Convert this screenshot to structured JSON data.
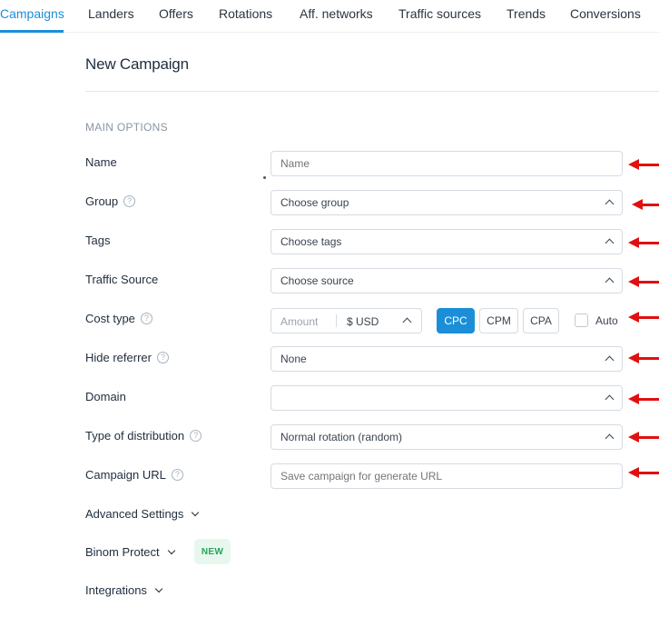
{
  "nav": {
    "tabs": [
      {
        "label": "Campaigns",
        "active": true
      },
      {
        "label": "Landers"
      },
      {
        "label": "Offers"
      },
      {
        "label": "Rotations"
      },
      {
        "label": "Aff. networks"
      },
      {
        "label": "Traffic sources"
      },
      {
        "label": "Trends"
      },
      {
        "label": "Conversions"
      }
    ]
  },
  "page": {
    "title": "New Campaign",
    "section_title": "MAIN OPTIONS"
  },
  "form": {
    "name": {
      "label": "Name",
      "placeholder": "Name"
    },
    "group": {
      "label": "Group",
      "value": "Choose group"
    },
    "tags": {
      "label": "Tags",
      "value": "Choose tags"
    },
    "traffic_source": {
      "label": "Traffic Source",
      "value": "Choose source"
    },
    "cost_type": {
      "label": "Cost type",
      "amount_placeholder": "Amount",
      "currency": "$ USD",
      "options": [
        "CPC",
        "CPM",
        "CPA"
      ],
      "selected": "CPC",
      "auto_label": "Auto",
      "auto_checked": false
    },
    "hide_referrer": {
      "label": "Hide referrer",
      "value": "None"
    },
    "domain": {
      "label": "Domain",
      "value": ""
    },
    "distribution": {
      "label": "Type of distribution",
      "value": "Normal rotation (random)"
    },
    "campaign_url": {
      "label": "Campaign URL",
      "placeholder": "Save campaign for generate URL"
    }
  },
  "sections": {
    "advanced": "Advanced Settings",
    "protect": "Binom Protect",
    "protect_badge": "NEW",
    "integrations": "Integrations"
  },
  "colors": {
    "accent": "#1a8fd8",
    "annotation_arrow": "#e01010",
    "badge_bg": "#e8f7ee",
    "badge_text": "#27a35a"
  }
}
